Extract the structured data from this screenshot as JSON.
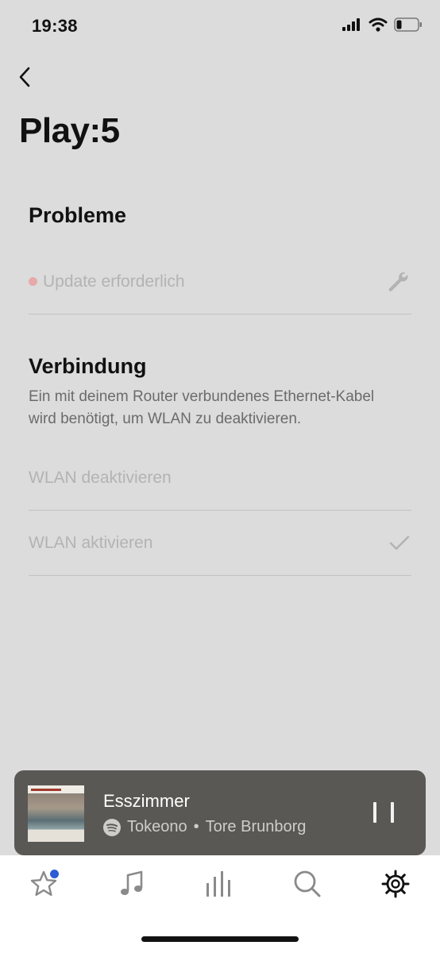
{
  "status_bar": {
    "time": "19:38"
  },
  "header": {
    "title": "Play:5"
  },
  "problems": {
    "heading": "Probleme",
    "items": [
      {
        "label": "Update erforderlich",
        "icon": "wrench-icon"
      }
    ]
  },
  "connection": {
    "heading": "Verbindung",
    "description": "Ein mit deinem Router verbundenes Ethernet-Kabel wird benötigt, um WLAN zu deaktivieren.",
    "options": [
      {
        "label": "WLAN deaktivieren",
        "selected": false
      },
      {
        "label": "WLAN aktivieren",
        "selected": true
      }
    ]
  },
  "now_playing": {
    "room": "Esszimmer",
    "track": "Tokeono",
    "separator": "•",
    "artist": "Tore Brunborg",
    "source_icon": "spotify-icon"
  },
  "tabs": [
    {
      "icon": "star-icon",
      "badge": true
    },
    {
      "icon": "music-note-icon",
      "badge": false
    },
    {
      "icon": "equalizer-bars-icon",
      "badge": false
    },
    {
      "icon": "search-icon",
      "badge": false
    },
    {
      "icon": "gear-icon",
      "badge": false,
      "active": true
    }
  ],
  "colors": {
    "background": "#dcdcdc",
    "now_playing_bg": "#595854",
    "badge": "#2d5bd6",
    "issue_dot": "#e7a9a9"
  }
}
